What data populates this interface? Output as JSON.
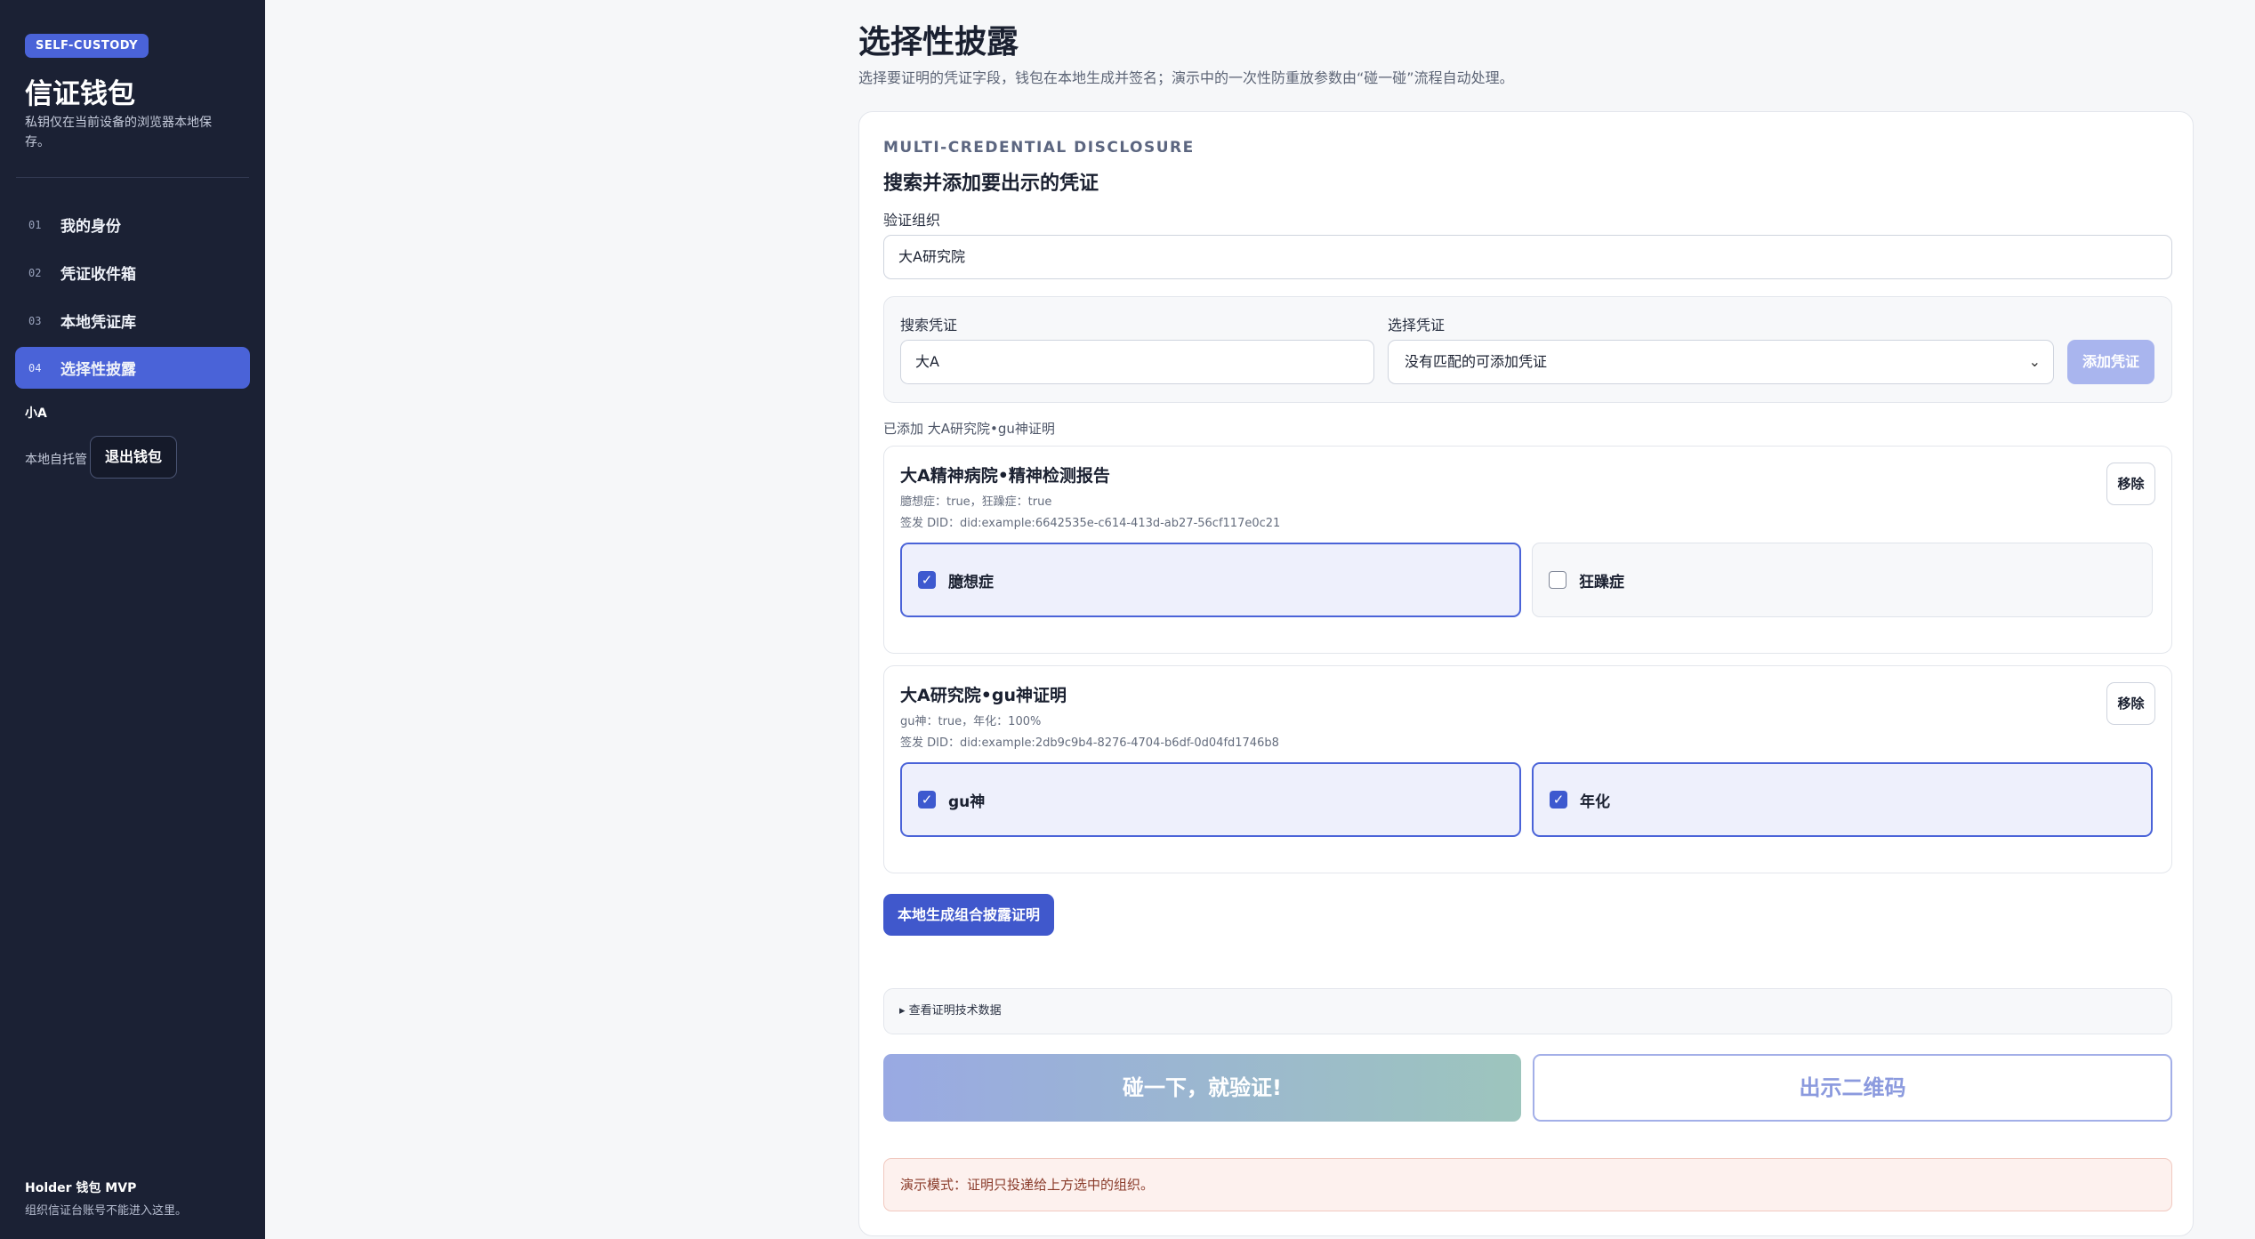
{
  "sidebar": {
    "badge": "SELF-CUSTODY",
    "title": "信证钱包",
    "desc": "私钥仅在当前设备的浏览器本地保存。",
    "nav": [
      {
        "num": "01",
        "label": "我的身份"
      },
      {
        "num": "02",
        "label": "凭证收件箱"
      },
      {
        "num": "03",
        "label": "本地凭证库"
      },
      {
        "num": "04",
        "label": "选择性披露"
      }
    ],
    "active_index": 3,
    "user_name": "小A",
    "user_status": "本地自托管",
    "logout_label": "退出钱包",
    "footer_title": "Holder 钱包 MVP",
    "footer_desc": "组织信证台账号不能进入这里。"
  },
  "main": {
    "title": "选择性披露",
    "subtitle": "选择要证明的凭证字段，钱包在本地生成并签名；演示中的一次性防重放参数由“碰一碰”流程自动处理。",
    "eyebrow": "MULTI-CREDENTIAL DISCLOSURE",
    "card_title": "搜索并添加要出示的凭证",
    "org_label": "验证组织",
    "org_value": "大A研究院",
    "search_label": "搜索凭证",
    "search_value": "大A",
    "select_label": "选择凭证",
    "select_value": "没有匹配的可添加凭证",
    "add_label": "添加凭证",
    "added_text": "已添加 大A研究院•gu神证明",
    "credentials": [
      {
        "title": "大A精神病院•精神检测报告",
        "attrs": "臆想症：true，狂躁症：true",
        "did": "签发 DID：did:example:6642535e-c614-413d-ab27-56cf117e0c21",
        "remove_label": "移除",
        "options": [
          {
            "label": "臆想症",
            "checked": true
          },
          {
            "label": "狂躁症",
            "checked": false
          }
        ]
      },
      {
        "title": "大A研究院•gu神证明",
        "attrs": "gu神：true，年化：100%",
        "did": "签发 DID：did:example:2db9c9b4-8276-4704-b6df-0d04fd1746b8",
        "remove_label": "移除",
        "options": [
          {
            "label": "gu神",
            "checked": true
          },
          {
            "label": "年化",
            "checked": true
          }
        ]
      }
    ],
    "generate_label": "本地生成组合披露证明",
    "details_label": "▸ 查看证明技术数据",
    "tap_label": "碰一下，就验证!",
    "qr_label": "出示二维码",
    "demo_note": "演示模式：证明只投递给上方选中的组织。"
  },
  "colors": {
    "accent": "#4a63d8",
    "sidebar_bg": "#1b2134",
    "warn_bg": "#fdf1ee"
  }
}
